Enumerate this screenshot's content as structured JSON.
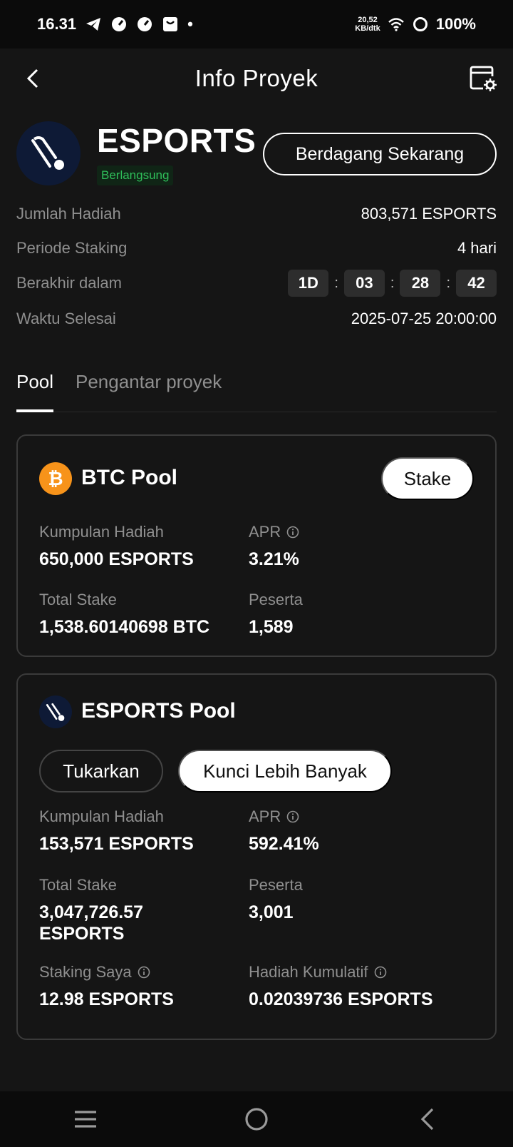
{
  "status_bar": {
    "time": "16.31",
    "network_speed_line1": "20,52",
    "network_speed_line2": "KB/dtk",
    "battery": "100%",
    "notification_dot": "•"
  },
  "header": {
    "title": "Info Proyek"
  },
  "project": {
    "name": "ESPORTS",
    "status": "Berlangsung",
    "trade_button": "Berdagang Sekarang"
  },
  "info": {
    "reward_label": "Jumlah Hadiah",
    "reward_value": "803,571 ESPORTS",
    "period_label": "Periode Staking",
    "period_value": "4 hari",
    "ends_label": "Berakhir dalam",
    "countdown": {
      "days": "1D",
      "hours": "03",
      "minutes": "28",
      "seconds": "42",
      "separator": ":"
    },
    "end_time_label": "Waktu Selesai",
    "end_time_value": "2025-07-25 20:00:00"
  },
  "tabs": {
    "pool": "Pool",
    "intro": "Pengantar proyek"
  },
  "btc_pool": {
    "title": "BTC Pool",
    "stake_button": "Stake",
    "reward_pool_label": "Kumpulan Hadiah",
    "reward_pool_value": "650,000 ESPORTS",
    "apr_label": "APR",
    "apr_value": "3.21%",
    "total_stake_label": "Total Stake",
    "total_stake_value": "1,538.60140698 BTC",
    "participants_label": "Peserta",
    "participants_value": "1,589"
  },
  "esports_pool": {
    "title": "ESPORTS Pool",
    "redeem_button": "Tukarkan",
    "lock_more_button": "Kunci Lebih Banyak",
    "reward_pool_label": "Kumpulan Hadiah",
    "reward_pool_value": "153,571 ESPORTS",
    "apr_label": "APR",
    "apr_value": "592.41%",
    "total_stake_label": "Total Stake",
    "total_stake_value_line1": "3,047,726.57",
    "total_stake_value_line2": "ESPORTS",
    "participants_label": "Peserta",
    "participants_value": "3,001",
    "my_staking_label": "Staking Saya",
    "my_staking_value": "12.98 ESPORTS",
    "cumulative_reward_label": "Hadiah Kumulatif",
    "cumulative_reward_value": "0.02039736 ESPORTS"
  },
  "colors": {
    "background": "#151515",
    "status_green": "#2fbf5a",
    "btc_orange": "#f7931a",
    "logo_navy": "#0e1a36"
  }
}
